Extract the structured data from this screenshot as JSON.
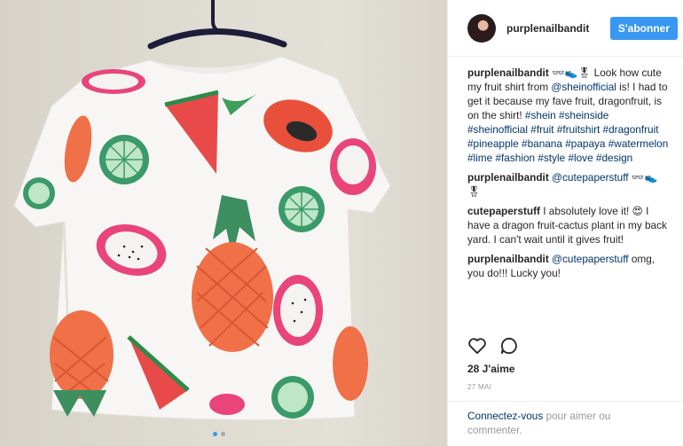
{
  "post": {
    "author": "purplenailbandit",
    "follow_label": "S'abonner",
    "caption": {
      "user": "purplenailbandit",
      "parts": [
        {
          "type": "text",
          "value": " 👓👟🎖 Look how cute my fruit shirt from "
        },
        {
          "type": "link",
          "value": "@sheinofficial"
        },
        {
          "type": "text",
          "value": " is! I had to get it because my fave fruit, dragonfruit, is on the shirt! "
        },
        {
          "type": "link",
          "value": "#shein #sheinside #sheinofficial #fruit #fruitshirt #dragonfruit #pineapple #banana #papaya #watermelon #lime #fashion #style #love #design"
        }
      ]
    },
    "comments": [
      {
        "user": "purplenailbandit",
        "parts": [
          {
            "type": "text",
            "value": " "
          },
          {
            "type": "link",
            "value": "@cutepaperstuff"
          },
          {
            "type": "text",
            "value": " 👓👟🎖"
          }
        ]
      },
      {
        "user": "cutepaperstuff",
        "parts": [
          {
            "type": "text",
            "value": " I absolutely love it! 😍 I have a dragon fruit-cactus plant in my back yard. I can't wait until it gives fruit!"
          }
        ]
      },
      {
        "user": "purplenailbandit",
        "parts": [
          {
            "type": "text",
            "value": " "
          },
          {
            "type": "link",
            "value": "@cutepaperstuff"
          },
          {
            "type": "text",
            "value": " omg, you do!!! Lucky you!"
          }
        ]
      }
    ],
    "likes": "28 J'aime",
    "date": "27 MAI",
    "login": {
      "connect": "Connectez-vous",
      "rest": " pour aimer ou commenter."
    },
    "icons": {
      "like": "heart-icon",
      "comment": "comment-bubble-icon"
    },
    "colors": {
      "accent": "#3897f0",
      "link": "#003569",
      "muted": "#999999"
    },
    "carousel": {
      "count": 2,
      "active": 1
    }
  }
}
